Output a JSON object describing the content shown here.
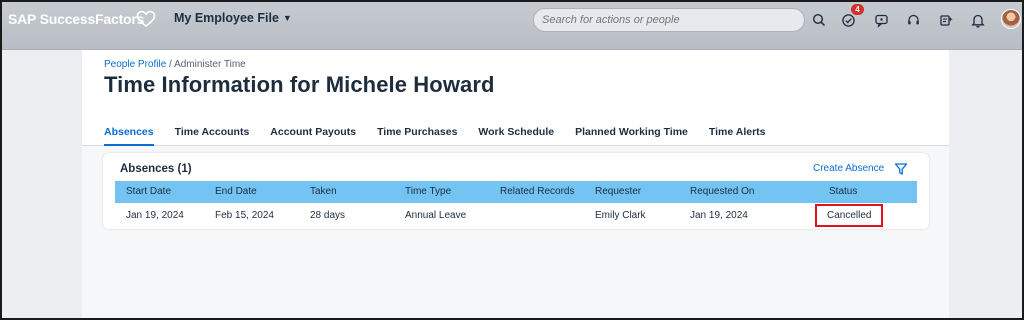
{
  "shell": {
    "brand": "SAP SuccessFactors",
    "app_menu": "My Employee File",
    "search_placeholder": "Search for actions or people",
    "notification_count": "4",
    "icons": [
      "search-icon",
      "approvals-icon",
      "chat-icon",
      "support-icon",
      "assistant-icon",
      "notifications-icon"
    ],
    "colors": {
      "shellbar": "#c0c4cb",
      "accent": "#0a6ed1",
      "table_header": "#74c4f3",
      "badge": "#d0312d",
      "highlight_box": "#e0141e"
    }
  },
  "breadcrumb": {
    "link": "People Profile",
    "separator": " / ",
    "current": "Administer Time"
  },
  "page": {
    "title": "Time Information for Michele Howard",
    "tabs": [
      {
        "label": "Absences",
        "active": true
      },
      {
        "label": "Time Accounts",
        "active": false
      },
      {
        "label": "Account Payouts",
        "active": false
      },
      {
        "label": "Time Purchases",
        "active": false
      },
      {
        "label": "Work Schedule",
        "active": false
      },
      {
        "label": "Planned Working Time",
        "active": false
      },
      {
        "label": "Time Alerts",
        "active": false
      }
    ]
  },
  "absences": {
    "title": "Absences (1)",
    "create_label": "Create Absence",
    "columns": [
      "Start Date",
      "End Date",
      "Taken",
      "Time Type",
      "Related Records",
      "Requester",
      "Requested On",
      "Status"
    ],
    "rows": [
      {
        "start_date": "Jan 19, 2024",
        "end_date": "Feb 15, 2024",
        "taken": "28 days",
        "time_type": "Annual Leave",
        "related_records": "",
        "requester": "Emily Clark",
        "requested_on": "Jan 19, 2024",
        "status": "Cancelled"
      }
    ]
  }
}
